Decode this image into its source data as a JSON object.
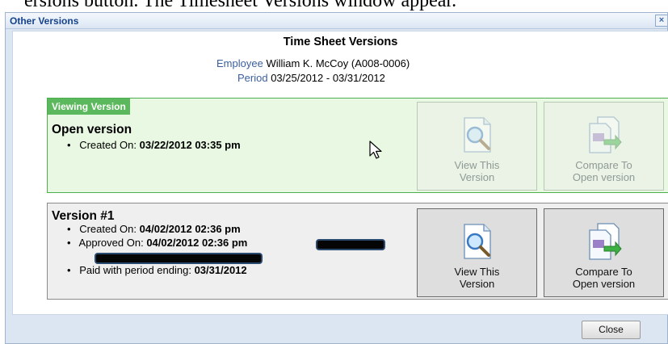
{
  "doc": {
    "top_text": "ersions button. The Timesheet Versions window appear."
  },
  "window": {
    "title": "Other Versions",
    "close_glyph": "×"
  },
  "header": {
    "title": "Time Sheet Versions",
    "employee_label": "Employee",
    "employee_value": "William K. McCoy (A008-0006)",
    "period_label": "Period",
    "period_value": "03/25/2012 - 03/31/2012"
  },
  "open_version": {
    "tag": "Viewing Version",
    "title": "Open version",
    "created_label": "Created On:",
    "created_value": "03/22/2012 03:35 pm",
    "view_button": {
      "line1": "View This",
      "line2": "Version",
      "icon": "magnifier-document-icon"
    },
    "compare_button": {
      "line1": "Compare To",
      "line2": "Open version",
      "icon": "compare-documents-icon"
    }
  },
  "version1": {
    "title": "Version #1",
    "created_label": "Created On:",
    "created_value": "04/02/2012 02:36 pm",
    "approved_label": "Approved On:",
    "approved_value": "04/02/2012 02:36 pm",
    "paid_label": "Paid with period ending:",
    "paid_value": "03/31/2012",
    "view_button": {
      "line1": "View This",
      "line2": "Version",
      "icon": "magnifier-document-icon"
    },
    "compare_button": {
      "line1": "Compare To",
      "line2": "Open version",
      "icon": "compare-documents-icon"
    }
  },
  "footer": {
    "close_label": "Close"
  },
  "colors": {
    "title_blue": "#15428b",
    "open_box_bg": "#e8f8e2",
    "open_box_border": "#4cae4c",
    "viewing_tag_bg": "#5cb85c",
    "window_bg": "#dce6f2"
  }
}
